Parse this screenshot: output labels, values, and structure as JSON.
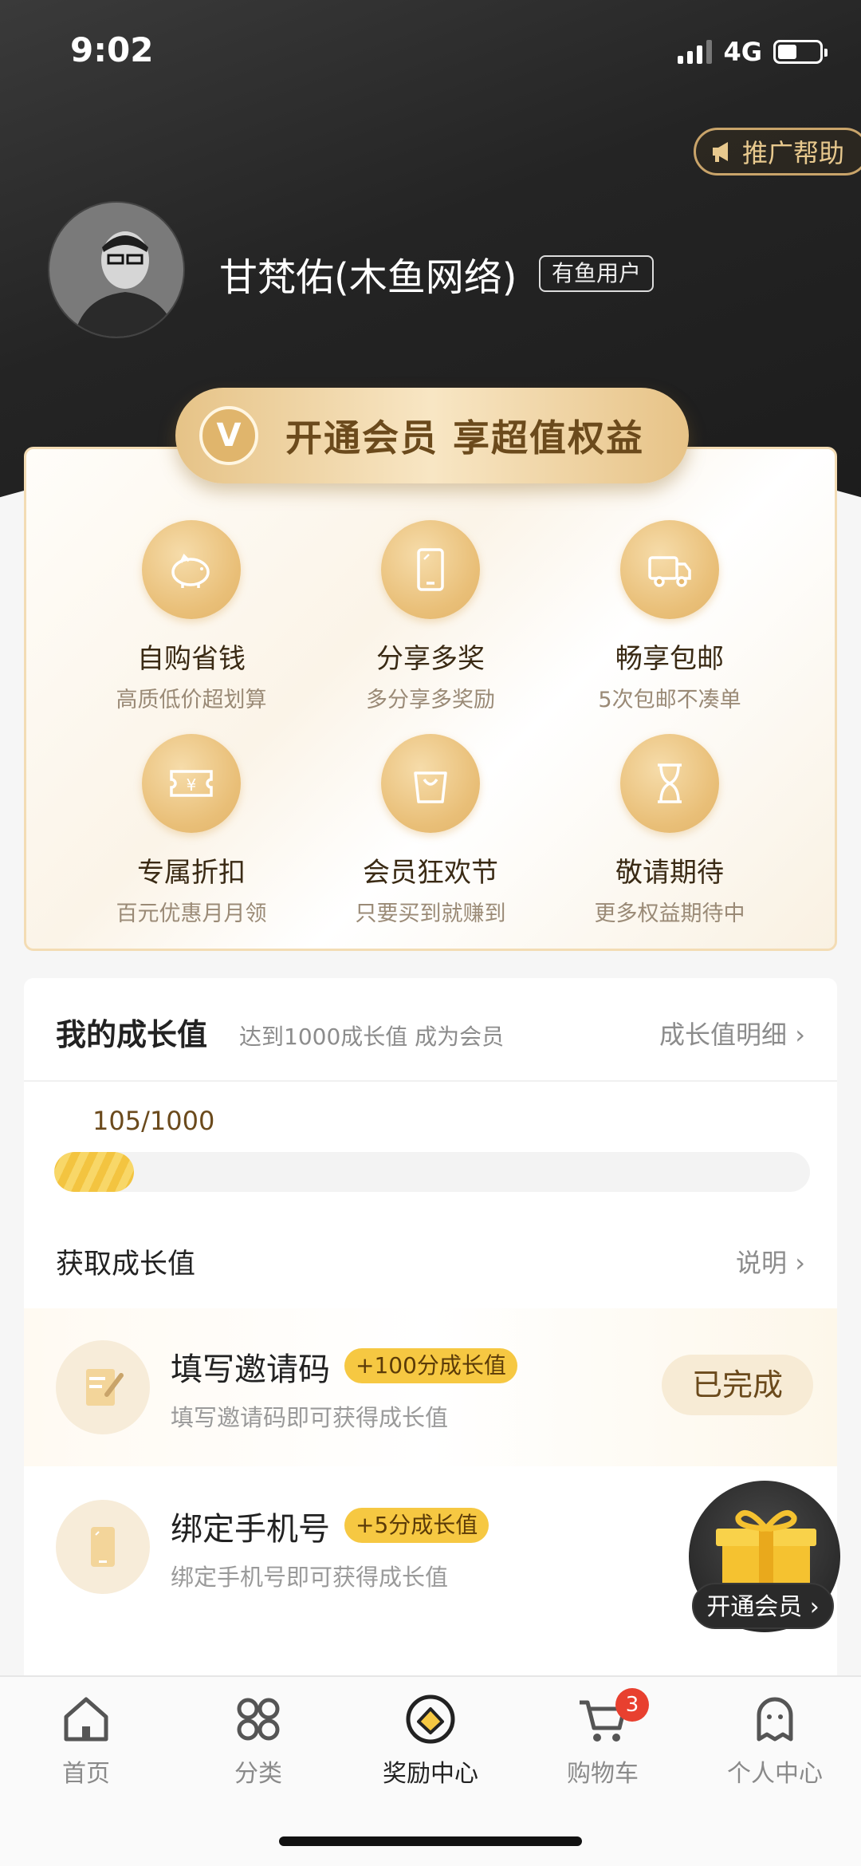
{
  "status_bar": {
    "time": "9:02",
    "network": "4G"
  },
  "header": {
    "promo_help": "推广帮助",
    "username": "甘梵佑(木鱼网络)",
    "user_badge": "有鱼用户"
  },
  "vip": {
    "banner_icon": "V",
    "banner_text": "开通会员 享超值权益",
    "perks": [
      {
        "icon": "piggy-bank-icon",
        "title": "自购省钱",
        "desc": "高质低价超划算"
      },
      {
        "icon": "phone-icon",
        "title": "分享多奖",
        "desc": "多分享多奖励"
      },
      {
        "icon": "truck-icon",
        "title": "畅享包邮",
        "desc": "5次包邮不凑单"
      },
      {
        "icon": "coupon-icon",
        "title": "专属折扣",
        "desc": "百元优惠月月领"
      },
      {
        "icon": "shopping-bag-icon",
        "title": "会员狂欢节",
        "desc": "只要买到就赚到"
      },
      {
        "icon": "hourglass-icon",
        "title": "敬请期待",
        "desc": "更多权益期待中"
      }
    ]
  },
  "growth": {
    "title": "我的成长值",
    "subtitle": "达到1000成长值 成为会员",
    "detail_link": "成长值明细 ›",
    "progress_text": "105/1000",
    "progress_value": 105,
    "progress_max": 1000,
    "earn_title": "获取成长值",
    "earn_help": "说明 ›",
    "tasks": [
      {
        "title": "填写邀请码",
        "tag": "+100分成长值",
        "desc": "填写邀请码即可获得成长值",
        "button": "已完成"
      },
      {
        "title": "绑定手机号",
        "tag": "+5分成长值",
        "desc": "绑定手机号即可获得成长值",
        "button": ""
      }
    ]
  },
  "floating": {
    "vip_button": "开通会员 ›"
  },
  "tabbar": {
    "tabs": [
      {
        "label": "首页",
        "icon": "home-icon"
      },
      {
        "label": "分类",
        "icon": "category-icon"
      },
      {
        "label": "奖励中心",
        "icon": "reward-icon"
      },
      {
        "label": "购物车",
        "icon": "cart-icon"
      },
      {
        "label": "个人中心",
        "icon": "profile-icon"
      }
    ],
    "cart_count": "3"
  },
  "colors": {
    "gold": "#e2b46a",
    "accent_yellow": "#f6c842",
    "badge_red": "#e8402f",
    "header_dark": "#242424"
  }
}
